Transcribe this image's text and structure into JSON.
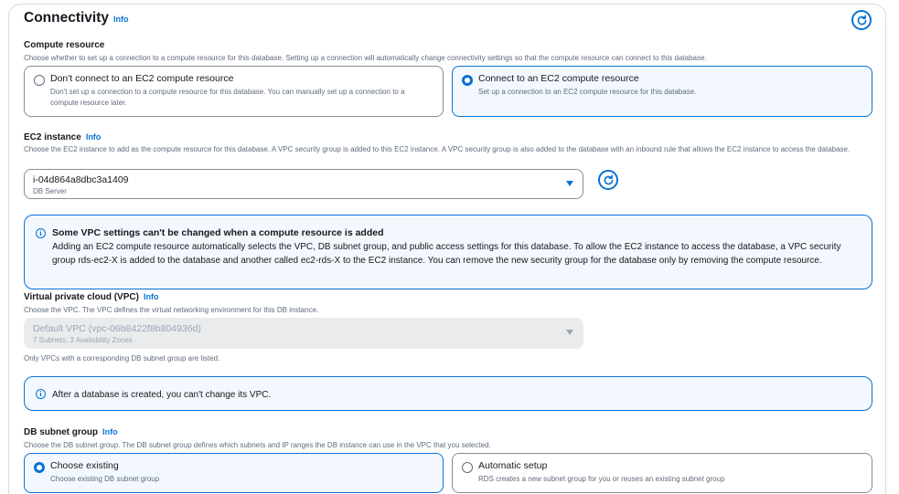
{
  "section": {
    "title": "Connectivity",
    "info_label": "Info"
  },
  "compute": {
    "label": "Compute resource",
    "description": "Choose whether to set up a connection to a compute resource for this database. Setting up a connection will automatically change connectivity settings so that the compute resource can connect to this database.",
    "options": [
      {
        "title": "Don't connect to an EC2 compute resource",
        "description": "Don't set up a connection to a compute resource for this database. You can manually set up a connection to a compute resource later.",
        "selected": false
      },
      {
        "title": "Connect to an EC2 compute resource",
        "description": "Set up a connection to an EC2 compute resource for this database.",
        "selected": true
      }
    ]
  },
  "ec2": {
    "label": "EC2 instance",
    "info_label": "Info",
    "description": "Choose the EC2 instance to add as the compute resource for this database. A VPC security group is added to this EC2 instance. A VPC security group is also added to the database with an inbound rule that allows the EC2 instance to access the database.",
    "selected_value": "i-04d864a8dbc3a1409",
    "selected_sub": "DB Server"
  },
  "alert_vpc_settings": {
    "title": "Some VPC settings can't be changed when a compute resource is added",
    "body": "Adding an EC2 compute resource automatically selects the VPC, DB subnet group, and public access settings for this database. To allow the EC2 instance to access the database, a VPC security group rds-ec2-X is added to the database and another called ec2-rds-X to the EC2 instance. You can remove the new security group for the database only by removing the compute resource."
  },
  "vpc": {
    "label": "Virtual private cloud (VPC)",
    "info_label": "Info",
    "description": "Choose the VPC. The VPC defines the virtual networking environment for this DB instance.",
    "selected_value": "Default VPC (vpc-06b8422f8b804936d)",
    "selected_sub": "7 Subnets, 3 Availability Zones",
    "hint": "Only VPCs with a corresponding DB subnet group are listed."
  },
  "alert_vpc_change": {
    "body": "After a database is created, you can't change its VPC."
  },
  "subnet": {
    "label": "DB subnet group",
    "info_label": "Info",
    "description": "Choose the DB subnet group. The DB subnet group defines which subnets and IP ranges the DB instance can use in the VPC that you selected.",
    "options": [
      {
        "title": "Choose existing",
        "description": "Choose existing DB subnet group",
        "selected": true
      },
      {
        "title": "Automatic setup",
        "description": "RDS creates a new subnet group for you or reuses an existing subnet group",
        "selected": false
      }
    ]
  },
  "colors": {
    "accent": "#0972d3",
    "selected_background": "#f2f8fd",
    "disabled_background": "#e9ebed"
  },
  "icons": {
    "refresh": "refresh-icon",
    "info": "info-circle-icon",
    "dropdown": "caret-down-icon"
  }
}
